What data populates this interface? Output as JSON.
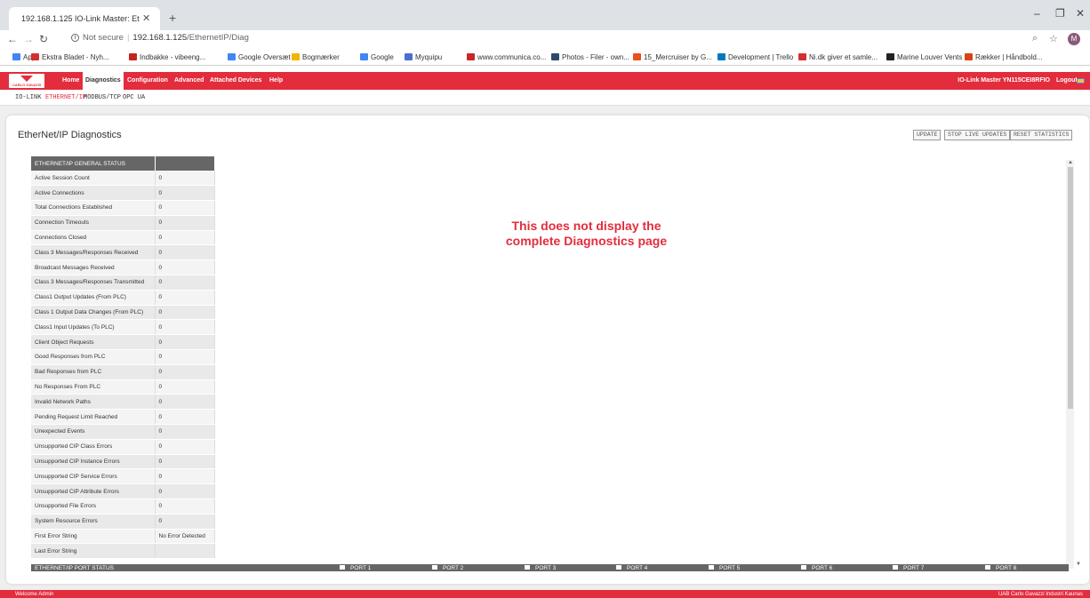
{
  "browser": {
    "tab_title": "192.168.1.125 IO-Link Master: Et",
    "url_prefix": "Not secure",
    "url_host": "192.168.1.125",
    "url_path": "/EthernetIP/Diag",
    "avatar_letter": "M",
    "bookmarks": [
      {
        "label": "Apps",
        "color": "#4285f4"
      },
      {
        "label": "Ekstra Bladet - Nyh...",
        "color": "#d32f2f"
      },
      {
        "label": "Indbakke - vibeeng...",
        "color": "#c5221f"
      },
      {
        "label": "Google Oversæt",
        "color": "#4285f4"
      },
      {
        "label": "Bogmærker",
        "color": "#f4b400"
      },
      {
        "label": "Google",
        "color": "#4285f4"
      },
      {
        "label": "Myquipu",
        "color": "#4a6fd3"
      },
      {
        "label": "www.communica.co...",
        "color": "#c62828"
      },
      {
        "label": "Photos - Filer - own...",
        "color": "#2d4a6b"
      },
      {
        "label": "15_Mercruiser by G...",
        "color": "#e8501e"
      },
      {
        "label": "Development | Trello",
        "color": "#0079bf"
      },
      {
        "label": "Ni.dk giver et samle...",
        "color": "#d32f2f"
      },
      {
        "label": "Marine Louver Vents",
        "color": "#222222"
      },
      {
        "label": "Rækker | Håndbold...",
        "color": "#d84315"
      }
    ]
  },
  "app": {
    "logo_text": "CARLO GAVAZZI",
    "menu": [
      "Home",
      "Diagnostics",
      "Configuration",
      "Advanced",
      "Attached Devices",
      "Help"
    ],
    "active_menu": "Diagnostics",
    "device": "IO-Link Master YN115CEI8RFIO",
    "logout": "Logout",
    "subnav": [
      "IO-LINK",
      "ETHERNET/IP",
      "MODBUS/TCP",
      "OPC UA"
    ],
    "active_subnav": "ETHERNET/IP",
    "accent": "#e32d3c"
  },
  "page": {
    "title": "EtherNet/IP Diagnostics",
    "buttons": {
      "update": "UPDATE",
      "stop": "STOP LIVE UPDATES",
      "reset": "RESET STATISTICS"
    },
    "table_header": "ETHERNET/IP GENERAL STATUS",
    "rows": [
      {
        "label": "Active Session Count",
        "value": "0"
      },
      {
        "label": "Active Connections",
        "value": "0"
      },
      {
        "label": "Total Connections Established",
        "value": "0"
      },
      {
        "label": "Connection Timeouts",
        "value": "0"
      },
      {
        "label": "Connections Closed",
        "value": "0"
      },
      {
        "label": "Class 3 Messages/Responses Received",
        "value": "0"
      },
      {
        "label": "Broadcast Messages Received",
        "value": "0"
      },
      {
        "label": "Class 3 Messages/Responses Transmitted",
        "value": "0"
      },
      {
        "label": "Class1 Output Updates (From PLC)",
        "value": "0"
      },
      {
        "label": "Class 1 Output Data Changes (From PLC)",
        "value": "0"
      },
      {
        "label": "Class1 Input Updates (To PLC)",
        "value": "0"
      },
      {
        "label": "Client Object Requests",
        "value": "0"
      },
      {
        "label": "Good Responses from PLC",
        "value": "0"
      },
      {
        "label": "Bad Responses from PLC",
        "value": "0"
      },
      {
        "label": "No Responses From PLC",
        "value": "0"
      },
      {
        "label": "Invalid Network Paths",
        "value": "0"
      },
      {
        "label": "Pending Request Limit Reached",
        "value": "0"
      },
      {
        "label": "Unexpected Events",
        "value": "0"
      },
      {
        "label": "Unsupported CIP Class Errors",
        "value": "0"
      },
      {
        "label": "Unsupported CIP Instance Errors",
        "value": "0"
      },
      {
        "label": "Unsupported CIP Service Errors",
        "value": "0"
      },
      {
        "label": "Unsupported CIP Attribute Errors",
        "value": "0"
      },
      {
        "label": "Unsupported File Errors",
        "value": "0"
      },
      {
        "label": "System Resource Errors",
        "value": "0"
      },
      {
        "label": "First Error String",
        "value": "No Error Detected"
      },
      {
        "label": "Last Error String",
        "value": ""
      }
    ],
    "note_line1": "This does not display the",
    "note_line2": "complete Diagnostics page",
    "port_status_title": "ETHERNET/IP PORT STATUS",
    "ports": [
      "PORT 1",
      "PORT 2",
      "PORT 3",
      "PORT 4",
      "PORT 5",
      "PORT 6",
      "PORT 7",
      "PORT 8"
    ]
  },
  "footer": {
    "left": "Welcome Admin",
    "right": "UAB Carlo Gavazzi Industri Kaunas"
  }
}
